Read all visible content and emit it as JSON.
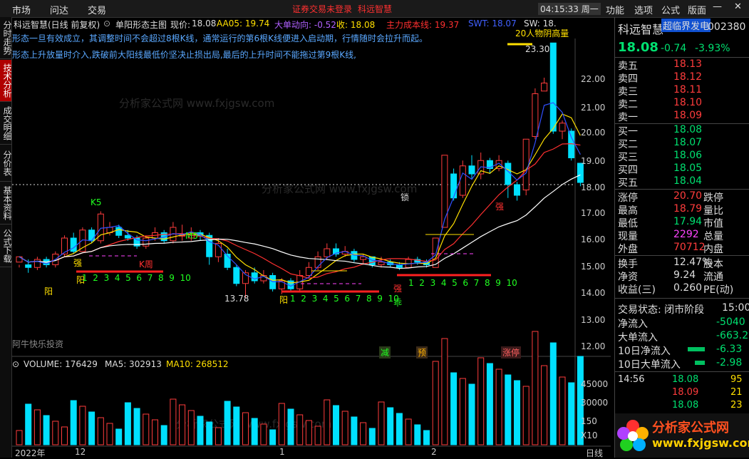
{
  "menu": {
    "left": [
      "市场",
      "问达",
      "交易"
    ],
    "notice": "证券交易未登录",
    "notice_stock": "科远智慧",
    "clock": "04:15:33 周一",
    "right": [
      "功能",
      "选项",
      "公式",
      "版面"
    ]
  },
  "left_tabs": [
    "分时走势",
    "技术分析",
    "成交明细",
    "分价表",
    "基本资料",
    "公式下载"
  ],
  "header": {
    "stock": "科远智慧(日线 前复权)",
    "formula": "单阳形态主图",
    "price_label": "现价:",
    "price_value": "18.08",
    "aa05": "AA05: 19.74",
    "big_flow": "大单动向: -0.52",
    "close": "收: 18.08",
    "cost_line": "主力成本线: 19.37",
    "swt": "SWT: 18.07",
    "sw": "SW: 18."
  },
  "notes": [
    "形态一旦有效成立，其调整时间不会超过8根K线，通常运行的第6根K线便进入启动期，行情随时会拉升而起。",
    "形态上升放量时介入,跌破前大阳线最低价坚决止损出局,最后的上升时间不能拖过第9根K线,"
  ],
  "axis_y": [
    "22.00",
    "21.00",
    "20.00",
    "19.00",
    "18.00",
    "17.00",
    "16.00",
    "15.00",
    "14.00",
    "13.00",
    "12.00"
  ],
  "axis_y_vol": [
    "45000",
    "30000",
    "150"
  ],
  "vol_unit": "X10",
  "chart_labels": {
    "high": "23.30",
    "low": "13.78",
    "k5": "K5",
    "m5": "M5",
    "kzhou": "K周",
    "qiang1": "强",
    "yang": "阳",
    "qiang2": "强",
    "qiang3": "强",
    "guai": "乖",
    "suo": "锁",
    "jian": "减",
    "yu": "预",
    "zhangting": "涨停",
    "top_text": "20人物阴高量",
    "brand": "阿牛快乐投资"
  },
  "count_labels": [
    "1",
    "2",
    "3",
    "4",
    "5",
    "6",
    "7",
    "8",
    "9",
    "10"
  ],
  "volume_header": {
    "volume": "VOLUME: 176429",
    "ma5": "MA5: 302913",
    "ma10": "MA10: 268512"
  },
  "x_axis": [
    "2022年",
    "12",
    "1",
    "2"
  ],
  "period": "日线",
  "watermark": "分析家公式网 www.fxjgsw.com",
  "right_panel": {
    "name": "科远智慧",
    "tag": "超临界发电",
    "code": "002380",
    "price": "18.08",
    "chg": "-0.74",
    "pct": "-3.93%",
    "sell": [
      {
        "l": "卖五",
        "p": "18.13"
      },
      {
        "l": "卖四",
        "p": "18.12"
      },
      {
        "l": "卖三",
        "p": "18.11"
      },
      {
        "l": "卖二",
        "p": "18.10"
      },
      {
        "l": "卖一",
        "p": "18.09"
      }
    ],
    "buy": [
      {
        "l": "买一",
        "p": "18.08"
      },
      {
        "l": "买二",
        "p": "18.07"
      },
      {
        "l": "买三",
        "p": "18.06"
      },
      {
        "l": "买四",
        "p": "18.05"
      },
      {
        "l": "买五",
        "p": "18.04"
      }
    ],
    "stats": [
      {
        "l": "涨停",
        "v": "20.70",
        "r": "跌停"
      },
      {
        "l": "最高",
        "v": "18.79",
        "r": "量比"
      },
      {
        "l": "最低",
        "v": "17.94",
        "r": "市值"
      },
      {
        "l": "现量",
        "v": "2292",
        "r": "总量"
      },
      {
        "l": "外盘",
        "v": "70712",
        "r": "内盘"
      },
      {
        "l": "换手",
        "v": "12.47%",
        "r": "股本"
      },
      {
        "l": "净资",
        "v": "9.24",
        "r": "流通"
      },
      {
        "l": "收益(三)",
        "v": "0.260",
        "r": "PE(动)"
      }
    ],
    "trade_state": "交易状态: 闭市阶段",
    "trade_time": "15:00",
    "flows": [
      {
        "l": "净流入",
        "v": "-5040"
      },
      {
        "l": "大单流入",
        "v": "-663.2"
      },
      {
        "l": "10日净流入",
        "v": "-6.33"
      },
      {
        "l": "10日大单流入",
        "v": "-2.98"
      }
    ],
    "ticks": [
      {
        "t": "14:56",
        "p": "18.08",
        "v": "95"
      },
      {
        "t": "",
        "p": "18.09",
        "v": "21"
      },
      {
        "t": "",
        "p": "18.08",
        "v": "23"
      }
    ]
  },
  "logo": {
    "text": "分析家公式网",
    "url": "www.fxjgsw.com"
  },
  "colors": {
    "up": "#ff3c3c",
    "down": "#00e0ff",
    "red_box": "#ff6060",
    "accent": "#ff3030"
  }
}
